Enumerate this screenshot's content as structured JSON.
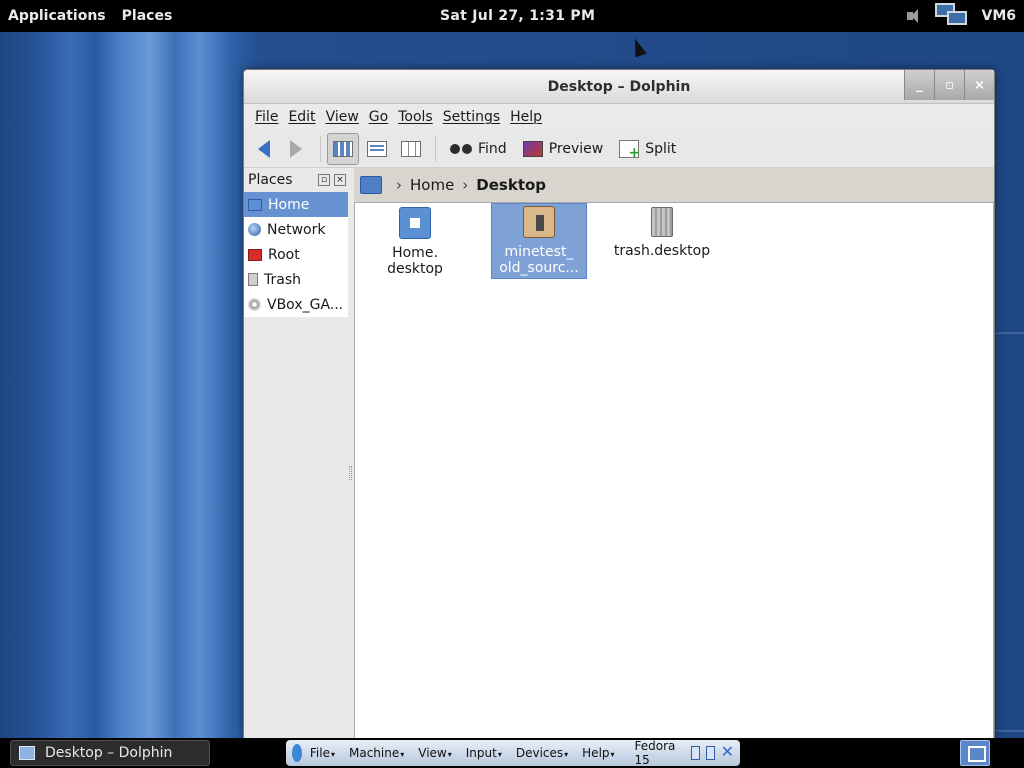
{
  "top_panel": {
    "applications_label": "Applications",
    "places_label": "Places",
    "clock": "Sat Jul 27,  1:31 PM",
    "user_label": "VM6"
  },
  "window": {
    "title": "Desktop – Dolphin",
    "menu": [
      "File",
      "Edit",
      "View",
      "Go",
      "Tools",
      "Settings",
      "Help"
    ],
    "toolbar": {
      "find_label": "Find",
      "preview_label": "Preview",
      "split_label": "Split"
    },
    "places": {
      "heading": "Places",
      "items": [
        {
          "label": "Home",
          "icon": "home-folder-icon",
          "selected": true
        },
        {
          "label": "Network",
          "icon": "network-globe-icon",
          "selected": false
        },
        {
          "label": "Root",
          "icon": "root-folder-icon",
          "selected": false
        },
        {
          "label": "Trash",
          "icon": "trash-icon",
          "selected": false
        },
        {
          "label": "VBox_GA...",
          "icon": "optical-disc-icon",
          "selected": false
        }
      ]
    },
    "breadcrumb": {
      "home_label": "Home",
      "current_label": "Desktop"
    },
    "files": [
      {
        "line1": "Home.",
        "line2": "desktop",
        "icon": "home-folder-icon",
        "selected": false
      },
      {
        "line1": "minetest_",
        "line2": "old_sourc...",
        "icon": "package-icon",
        "selected": true
      },
      {
        "line1": "trash.desktop",
        "line2": "",
        "icon": "trash-can-icon",
        "selected": false
      }
    ]
  },
  "bottom_panel": {
    "task_label": "Desktop – Dolphin",
    "vbox_menu": [
      "File",
      "Machine",
      "View",
      "Input",
      "Devices",
      "Help"
    ],
    "vm_name": "Fedora 15"
  },
  "colors": {
    "selection": "#6792d1",
    "panel_bg": "#000000",
    "desktop_blue": "#2a5b9c"
  }
}
